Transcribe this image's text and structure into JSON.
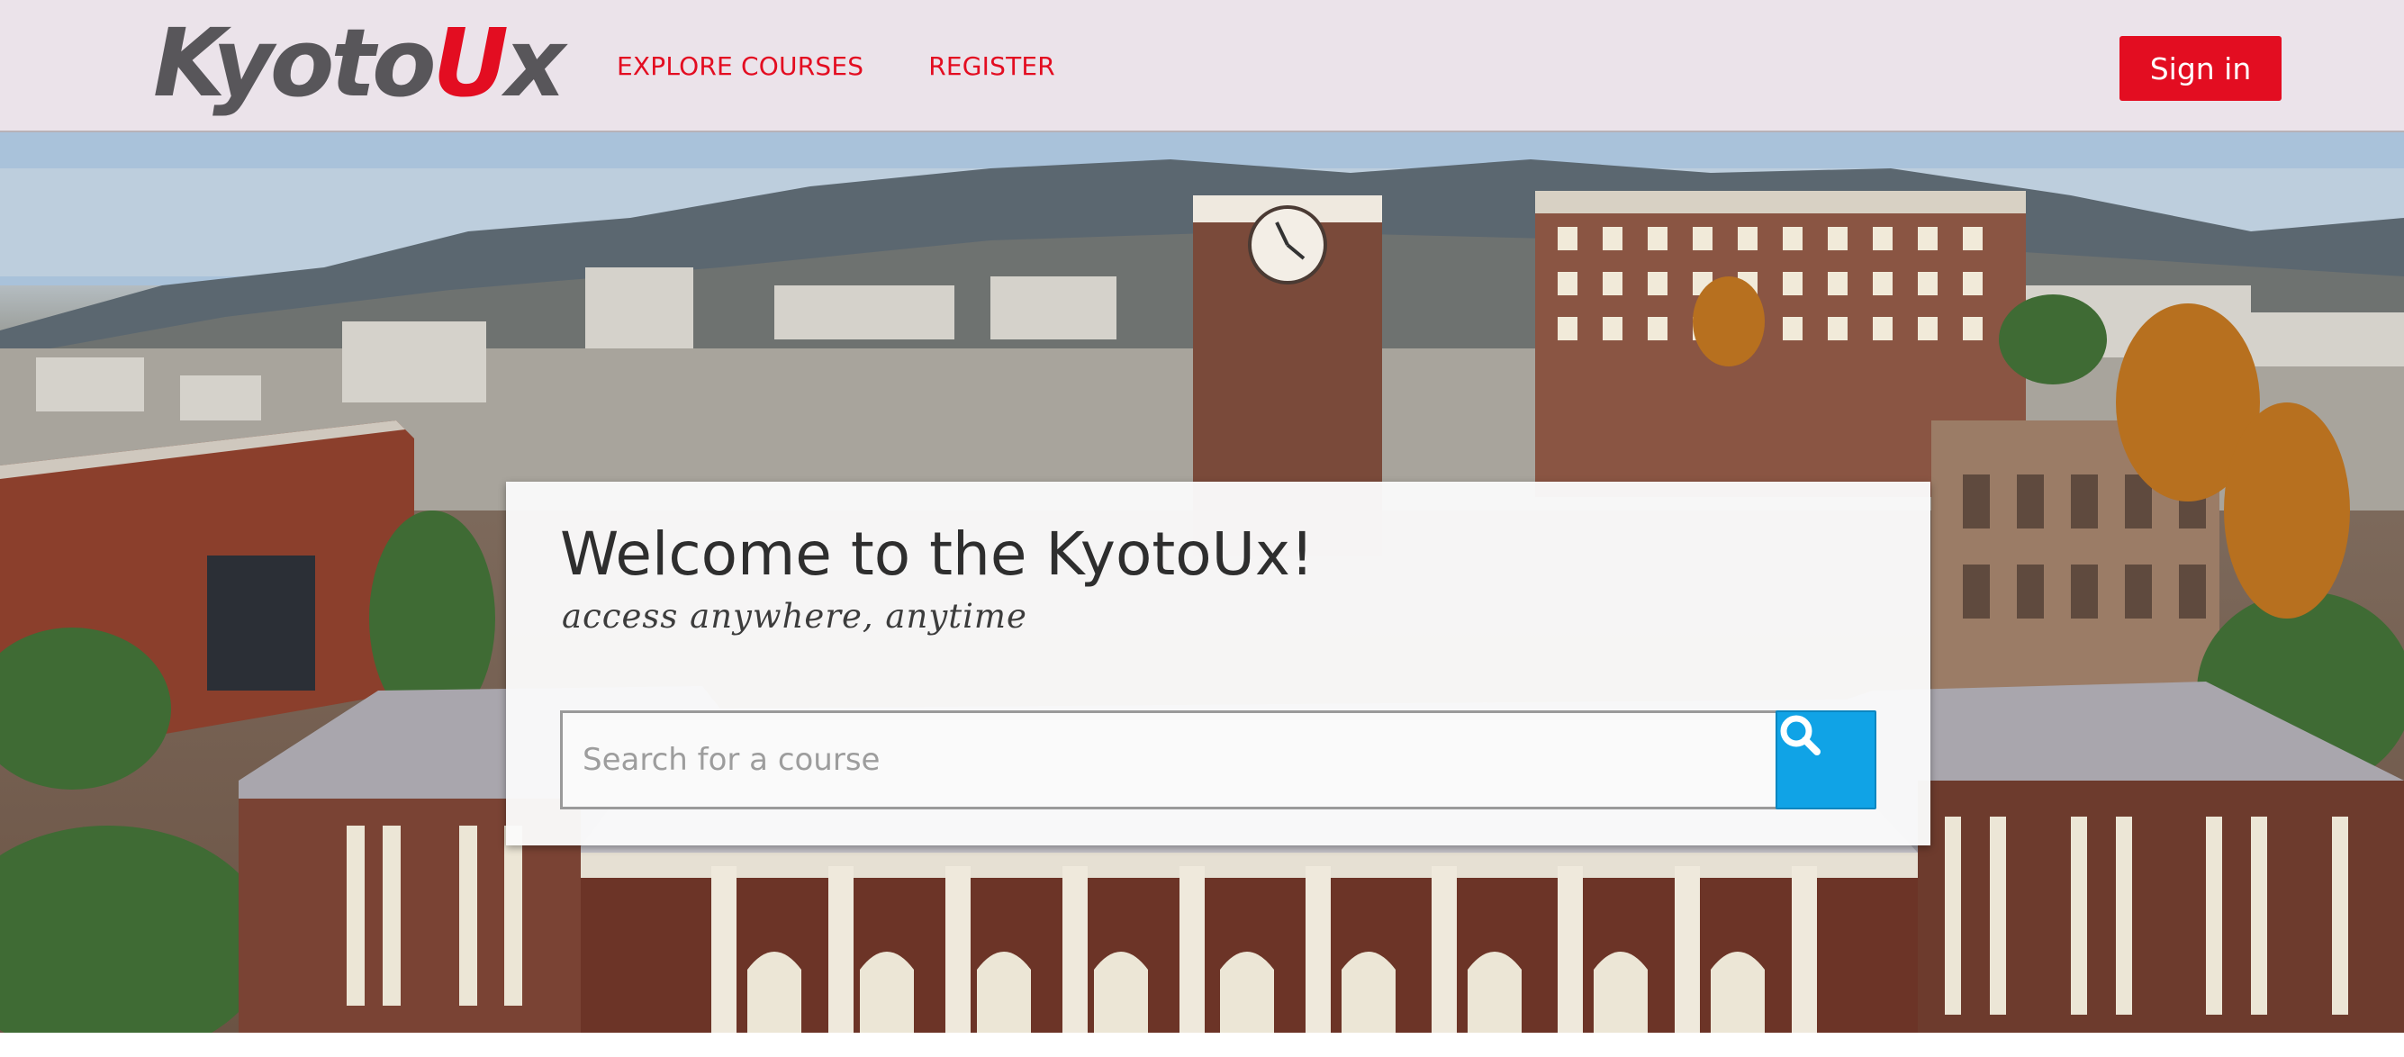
{
  "header": {
    "logo": {
      "part1": "Kyoto",
      "part2": "U",
      "part3": "x"
    },
    "nav": [
      {
        "label": "EXPLORE COURSES"
      },
      {
        "label": "REGISTER"
      }
    ],
    "signin_label": "Sign in"
  },
  "hero": {
    "title": "Welcome to the KyotoUx!",
    "subtitle": "access anywhere, anytime",
    "search": {
      "placeholder": "Search for a course",
      "button_icon": "search-icon"
    }
  },
  "colors": {
    "brand_red": "#e30d21",
    "header_bg": "#ebe3ea",
    "search_button": "#10a3e6",
    "logo_gray": "#58565a"
  }
}
